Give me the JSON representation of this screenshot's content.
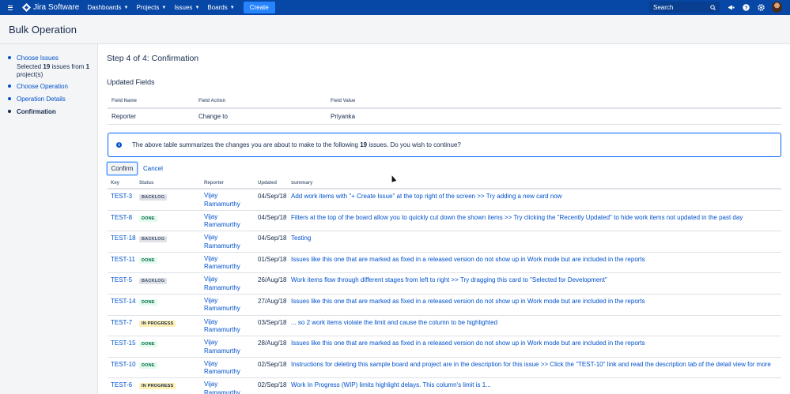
{
  "nav": {
    "product": "Jira Software",
    "items": [
      "Dashboards",
      "Projects",
      "Issues",
      "Boards"
    ],
    "create": "Create",
    "search_placeholder": "Search",
    "icons": [
      "notifications-icon",
      "help-icon",
      "settings-icon",
      "avatar"
    ]
  },
  "page": {
    "title": "Bulk Operation"
  },
  "sidebar": {
    "steps": [
      {
        "label": "Choose Issues",
        "state": "link"
      },
      {
        "label": "Choose Operation",
        "state": "link"
      },
      {
        "label": "Operation Details",
        "state": "link"
      },
      {
        "label": "Confirmation",
        "state": "current"
      }
    ],
    "selected_prefix": "Selected",
    "selected_count": "19",
    "selected_mid": "issues from",
    "project_count": "1",
    "selected_suffix": "project(s)"
  },
  "main": {
    "step_title": "Step 4 of 4: Confirmation",
    "updated_fields_title": "Updated Fields",
    "fields_headers": [
      "Field Name",
      "Field Action",
      "Field Value"
    ],
    "fields_rows": [
      {
        "name": "Reporter",
        "action": "Change to",
        "value": "Priyanka"
      }
    ],
    "info_prefix": "The above table summarizes the changes you are about to make to the following",
    "info_count": "19",
    "info_suffix": "issues. Do you wish to continue?",
    "confirm_label": "Confirm",
    "cancel_label": "Cancel"
  },
  "issues": {
    "headers": [
      "Key",
      "Status",
      "Reporter",
      "Updated",
      "Summary"
    ],
    "rows": [
      {
        "key": "TEST-3",
        "status": "BACKLOG",
        "reporter_first": "Vijay",
        "reporter_last": "Ramamurthy",
        "updated": "04/Sep/18",
        "summary": "Add work items with \"+ Create Issue\" at the top right of the screen >> Try adding a new card now"
      },
      {
        "key": "TEST-8",
        "status": "DONE",
        "reporter_first": "Vijay",
        "reporter_last": "Ramamurthy",
        "updated": "04/Sep/18",
        "summary": "Filters at the top of the board allow you to quickly cut down the shown items >> Try clicking the \"Recently Updated\" to hide work items not updated in the past day"
      },
      {
        "key": "TEST-18",
        "status": "BACKLOG",
        "reporter_first": "Vijay",
        "reporter_last": "Ramamurthy",
        "updated": "04/Sep/18",
        "summary": "Testing"
      },
      {
        "key": "TEST-11",
        "status": "DONE",
        "reporter_first": "Vijay",
        "reporter_last": "Ramamurthy",
        "updated": "01/Sep/18",
        "summary": "Issues like this one that are marked as fixed in a released version do not show up in Work mode but are included in the reports"
      },
      {
        "key": "TEST-5",
        "status": "BACKLOG",
        "reporter_first": "Vijay",
        "reporter_last": "Ramamurthy",
        "updated": "26/Aug/18",
        "summary": "Work items flow through different stages from left to right >> Try dragging this card to \"Selected for Development\""
      },
      {
        "key": "TEST-14",
        "status": "DONE",
        "reporter_first": "Vijay",
        "reporter_last": "Ramamurthy",
        "updated": "27/Aug/18",
        "summary": "Issues like this one that are marked as fixed in a released version do not show up in Work mode but are included in the reports"
      },
      {
        "key": "TEST-7",
        "status": "IN PROGRESS",
        "reporter_first": "Vijay",
        "reporter_last": "Ramamurthy",
        "updated": "03/Sep/18",
        "summary": "... so 2 work items violate the limit and cause the column to be highlighted"
      },
      {
        "key": "TEST-15",
        "status": "DONE",
        "reporter_first": "Vijay",
        "reporter_last": "Ramamurthy",
        "updated": "28/Aug/18",
        "summary": "Issues like this one that are marked as fixed in a released version do not show up in Work mode but are included in the reports"
      },
      {
        "key": "TEST-10",
        "status": "DONE",
        "reporter_first": "Vijay",
        "reporter_last": "Ramamurthy",
        "updated": "02/Sep/18",
        "summary": "Instructions for deleting this sample board and project are in the description for this issue >> Click the \"TEST-10\" link and read the description tab of the detail view for more"
      },
      {
        "key": "TEST-6",
        "status": "IN PROGRESS",
        "reporter_first": "Vijay",
        "reporter_last": "Ramamurthy",
        "updated": "02/Sep/18",
        "summary": "Work In Progress (WIP) limits highlight delays. This column's limit is 1..."
      }
    ]
  },
  "colors": {
    "nav": "#0747a6",
    "create": "#2684ff",
    "link": "#0052cc",
    "info_border": "#0065ff"
  }
}
